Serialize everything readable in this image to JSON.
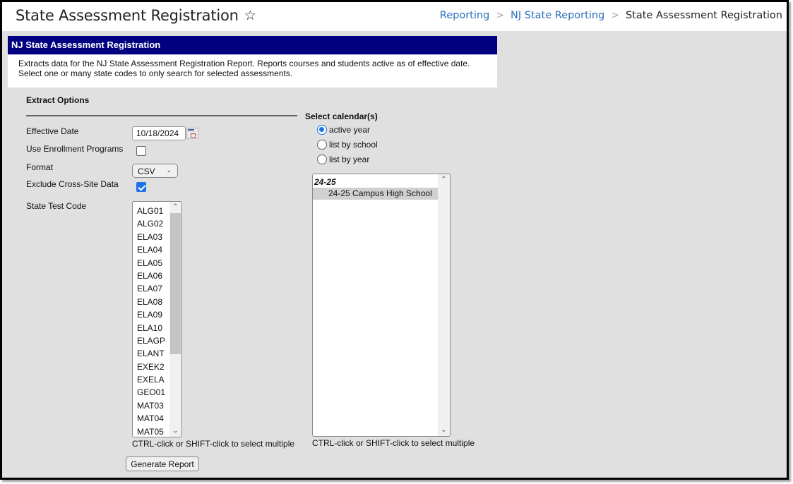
{
  "header": {
    "title": "State Assessment Registration",
    "favorite_icon": "star-outline-icon",
    "breadcrumb": [
      {
        "label": "Reporting",
        "link": true
      },
      {
        "label": "NJ State Reporting",
        "link": true
      },
      {
        "label": "State Assessment Registration",
        "link": false
      }
    ],
    "breadcrumb_separator": ">"
  },
  "panel": {
    "title": "NJ State Assessment Registration",
    "description_line1": "Extracts data for the NJ State Assessment Registration Report. Reports courses and students active as of effective date.",
    "description_line2": "Select one or many state codes to only search for selected assessments."
  },
  "extract_options": {
    "section_title": "Extract Options",
    "effective_date_label": "Effective Date",
    "effective_date_value": "10/18/2024",
    "calendar_icon": "calendar-icon",
    "use_enrollment_programs_label": "Use Enrollment Programs",
    "use_enrollment_programs_checked": false,
    "format_label": "Format",
    "format_value": "CSV",
    "exclude_cross_site_label": "Exclude Cross-Site Data",
    "exclude_cross_site_checked": true,
    "state_test_code_label": "State Test Code",
    "state_test_codes": [
      "ALG01",
      "ALG02",
      "ELA03",
      "ELA04",
      "ELA05",
      "ELA06",
      "ELA07",
      "ELA08",
      "ELA09",
      "ELA10",
      "ELAGP",
      "ELANT",
      "EXEK2",
      "EXELA",
      "GEO01",
      "MAT03",
      "MAT04",
      "MAT05"
    ],
    "multi_select_hint": "CTRL-click or SHIFT-click to select multiple",
    "generate_button": "Generate Report"
  },
  "calendars": {
    "title": "Select calendar(s)",
    "radio_options": [
      {
        "label": "active year",
        "selected": true
      },
      {
        "label": "list by school",
        "selected": false
      },
      {
        "label": "list by year",
        "selected": false
      }
    ],
    "groups": [
      {
        "label": "24-25",
        "options": [
          "24-25 Campus High School"
        ]
      }
    ],
    "multi_select_hint": "CTRL-click or SHIFT-click to select multiple"
  },
  "colors": {
    "panel_header_bg": "#000080",
    "link": "#2a6ebb",
    "checkbox_accent": "#1a73e8",
    "page_bg": "#e0e0e0"
  }
}
